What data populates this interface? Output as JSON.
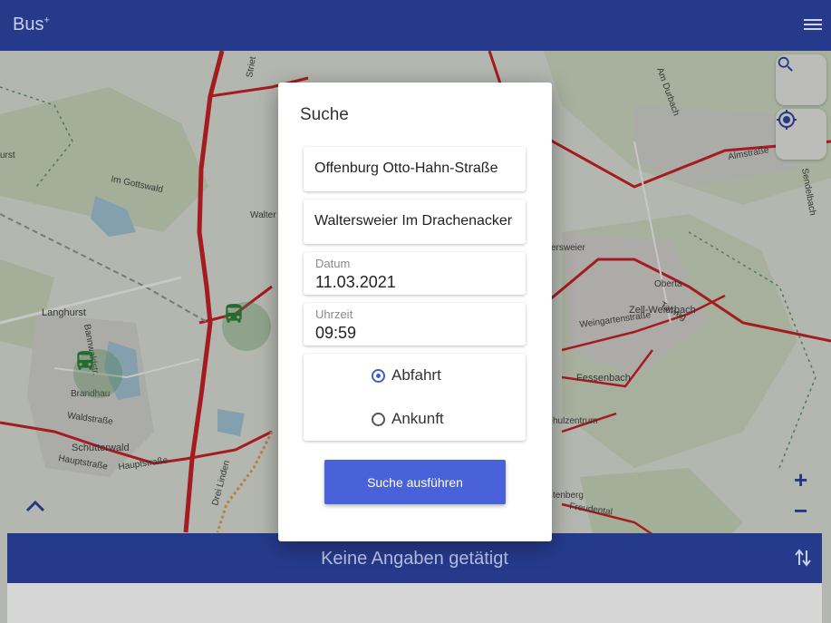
{
  "app": {
    "title": "Bus",
    "title_sup": "+"
  },
  "map": {
    "labels": [
      "Im Gottswald",
      "Walter",
      "Langhurst",
      "Brandhau",
      "Waldstraße",
      "Schutterwald",
      "Hauptstraße",
      "Hauptstraße",
      "Drei Linden",
      "Zell-Weierbach",
      "Fessenbach",
      "Oberta",
      "Talweg",
      "Almstraße",
      "Sendelbach",
      "Am Durbach",
      "ersweier",
      "hulzentrum",
      "tenberg",
      "Freudental",
      "Weingartenstraße",
      "Striet",
      "urst",
      "Bannwaldstr."
    ],
    "zoom_in": "+",
    "zoom_out": "−"
  },
  "dialog": {
    "title": "Suche",
    "from_value": "Offenburg Otto-Hahn-Straße",
    "to_value": "Waltersweier Im Drachenacker",
    "date_label": "Datum",
    "date_value": "11.03.2021",
    "time_label": "Uhrzeit",
    "time_value": "09:59",
    "radio_departure": "Abfahrt",
    "radio_arrival": "Ankunft",
    "selected": "Abfahrt",
    "submit_label": "Suche ausführen"
  },
  "bottom": {
    "summary": "Keine Angaben getätigt"
  },
  "colors": {
    "primary": "#263a8c",
    "accent": "#4a62d9",
    "road": "#d2232a"
  },
  "icons": [
    "menu-icon",
    "search-icon",
    "locate-icon",
    "bus-icon",
    "chevron-up-icon",
    "swap-vertical-icon"
  ]
}
